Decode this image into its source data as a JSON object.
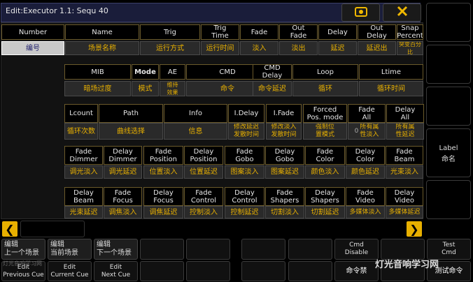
{
  "title": "Edit:Executor 1.1: Sequ 40",
  "icons": {
    "title_screen": "screen-icon",
    "title_close": "close-icon"
  },
  "colors": {
    "accent": "#e8b000",
    "title_bg": "#1a1d3a",
    "selected_bg": "#c9c9c9"
  },
  "group1": {
    "headers": [
      "Number",
      "Name",
      "Trig",
      "Trig\nTime",
      "Fade",
      "Out\nFade",
      "Delay",
      "Out\nDelay",
      "Snap\nPercent"
    ],
    "values": [
      "编号",
      "场景名称",
      "运行方式",
      "运行时间",
      "淡入",
      "淡出",
      "延迟",
      "延迟出",
      "突变百分比"
    ]
  },
  "group2": {
    "headers": [
      "MIB",
      "Mode",
      "AE",
      "CMD",
      "CMD\nDelay",
      "Loop",
      "Ltime"
    ],
    "values": [
      "暗场过度",
      "模式",
      "维持\n效果",
      "命令",
      "命令延迟",
      "循环",
      "循环时间"
    ]
  },
  "group3": {
    "headers": [
      "Lcount",
      "Path",
      "Info",
      "I.Delay",
      "I.Fade",
      "Forced\nPos. mode",
      "Fade\nAll",
      "Delay\nAll"
    ],
    "values": [
      "循环次数",
      "曲线选择",
      "信息",
      "修改延迟\n发散时间",
      "修改淡入\n发散时间",
      "强制位\n置模式",
      "所有属\n性淡入",
      "所有属\n性延迟"
    ],
    "value_prefix": [
      "",
      "",
      "",
      "",
      "",
      "",
      "0",
      ""
    ]
  },
  "group4": {
    "headers": [
      "Fade\nDimmer",
      "Delay\nDimmer",
      "Fade\nPosition",
      "Delay\nPosition",
      "Fade\nGobo",
      "Delay\nGobo",
      "Fade\nColor",
      "Delay\nColor",
      "Fade\nBeam"
    ],
    "values": [
      "调光淡入",
      "调光延迟",
      "位置淡入",
      "位置延迟",
      "图案淡入",
      "图案延迟",
      "颜色淡入",
      "颜色延迟",
      "光束淡入"
    ]
  },
  "group5": {
    "headers": [
      "Delay\nBeam",
      "Fade\nFocus",
      "Delay\nFocus",
      "Fade\nControl",
      "Delay\nControl",
      "Fade\nShapers",
      "Delay\nShapers",
      "Fade\nVideo",
      "Delay\nVideo"
    ],
    "values": [
      "光束延迟",
      "调焦淡入",
      "调焦延迟",
      "控制淡入",
      "控制延迟",
      "切割淡入",
      "切割延迟",
      "多媒体淡入",
      "多媒体延迟"
    ]
  },
  "label_button": {
    "line1": "Label",
    "line2": "命名"
  },
  "bottom": {
    "cue_buttons": [
      {
        "top": "编辑\n上一个场景",
        "bottom": "Edit\nPrevious Cue"
      },
      {
        "top": "编辑\n当前场景",
        "bottom": "Edit\nCurrent Cue"
      },
      {
        "top": "编辑\n下一个场景",
        "bottom": "Edit\nNext Cue"
      }
    ],
    "cmd_disable": "Cmd\nDisable",
    "cmd_disable_cn": "命令禁",
    "test_cmd": "Test\nCmd",
    "test_cmd_cn": "测试命令",
    "watermark_left": "灯光音响学习网",
    "watermark_right": "灯光音响学习网"
  }
}
